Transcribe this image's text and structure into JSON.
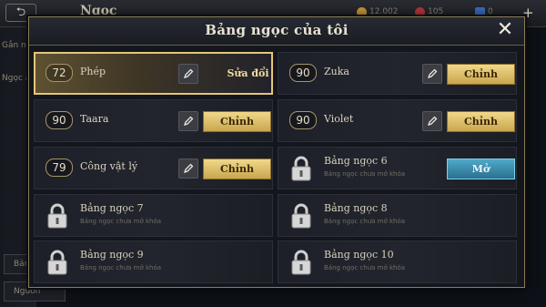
{
  "background": {
    "back_label": "⮌",
    "title": "Ngọc",
    "resource_coins": "12.002",
    "resource_gems": "105",
    "resource_other": "0",
    "plus_label": "+",
    "left_texts": [
      "Gắn ng",
      "Ngọc a"
    ],
    "button_1": "Bảng",
    "button_2": "Ngươn"
  },
  "modal": {
    "title": "Bảng ngọc của tôi",
    "close_label": "✕"
  },
  "slots": [
    {
      "level": "72",
      "name": "Phép",
      "action": "Sửa đổi",
      "active": true
    },
    {
      "level": "90",
      "name": "Zuka",
      "action": "Chỉnh"
    },
    {
      "level": "90",
      "name": "Taara",
      "action": "Chỉnh"
    },
    {
      "level": "90",
      "name": "Violet",
      "action": "Chỉnh"
    },
    {
      "level": "79",
      "name": "Công vật lý",
      "action": "Chỉnh"
    },
    {
      "name": "Bảng ngọc 6",
      "sub": "Bảng ngọc chưa mở khóa",
      "action": "Mở"
    },
    {
      "name": "Bảng ngọc 7",
      "sub": "Bảng ngọc chưa mở khóa"
    },
    {
      "name": "Bảng ngọc 8",
      "sub": "Bảng ngọc chưa mở khóa"
    },
    {
      "name": "Bảng ngọc 9",
      "sub": "Bảng ngọc chưa mở khóa"
    },
    {
      "name": "Bảng ngọc 10",
      "sub": "Bảng ngọc chưa mở khóa"
    }
  ],
  "colors": {
    "gold_button": "#d9bb66",
    "open_button": "#3c8db0",
    "active_border": "#e3c777"
  }
}
